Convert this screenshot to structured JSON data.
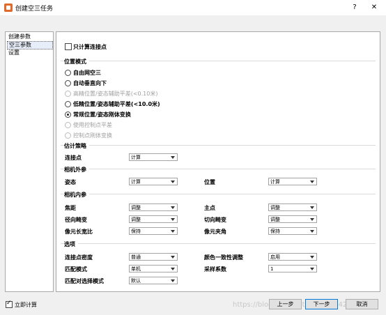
{
  "window": {
    "title": "创建空三任务",
    "help": "?",
    "close": "✕"
  },
  "nav": {
    "items": [
      "创建参数",
      "空三参数",
      "设置"
    ],
    "selected_index": 1
  },
  "only_tie_points": {
    "label": "只计算连接点",
    "checked": false
  },
  "position_mode": {
    "title": "位置模式",
    "options": [
      {
        "label": "自由网空三",
        "enabled": true,
        "selected": false
      },
      {
        "label": "自动垂直向下",
        "enabled": true,
        "selected": false
      },
      {
        "label": "高精位置/姿态辅助平差(<0.10米)",
        "enabled": false,
        "selected": false
      },
      {
        "label": "低精位置/姿态辅助平差(<10.0米)",
        "enabled": true,
        "selected": false
      },
      {
        "label": "常规位置/姿态刚体变换",
        "enabled": true,
        "selected": true
      },
      {
        "label": "使用控制点平差",
        "enabled": false,
        "selected": false
      },
      {
        "label": "控制点刚体变换",
        "enabled": false,
        "selected": false
      }
    ]
  },
  "estimation": {
    "title": "估计策略",
    "tie_points_label": "连接点",
    "tie_points_value": "计算"
  },
  "extrinsics": {
    "title": "相机外参",
    "rotation_label": "姿态",
    "rotation_value": "计算",
    "position_label": "位置",
    "position_value": "计算"
  },
  "intrinsics": {
    "title": "相机内参",
    "focal_label": "焦距",
    "focal_value": "调整",
    "principal_label": "主点",
    "principal_value": "调整",
    "radial_label": "径向畸变",
    "radial_value": "调整",
    "tangential_label": "切向畸变",
    "tangential_value": "调整",
    "aspect_label": "像元长宽比",
    "aspect_value": "保持",
    "skew_label": "像元夹角",
    "skew_value": "保持"
  },
  "options": {
    "title": "选项",
    "density_label": "连接点密度",
    "density_value": "普通",
    "color_label": "颜色一致性调整",
    "color_value": "启用",
    "match_label": "匹配模式",
    "match_value": "单机",
    "sampling_label": "采样系数",
    "sampling_value": "1",
    "pair_label": "匹配对选择模式",
    "pair_value": "默认"
  },
  "footer": {
    "compute_now_label": "立即计算",
    "compute_now_checked": true,
    "prev_label": "上一步",
    "next_label": "下一步",
    "cancel_label": "取消"
  },
  "watermark": "https://blog.csdn.net/u012066426"
}
